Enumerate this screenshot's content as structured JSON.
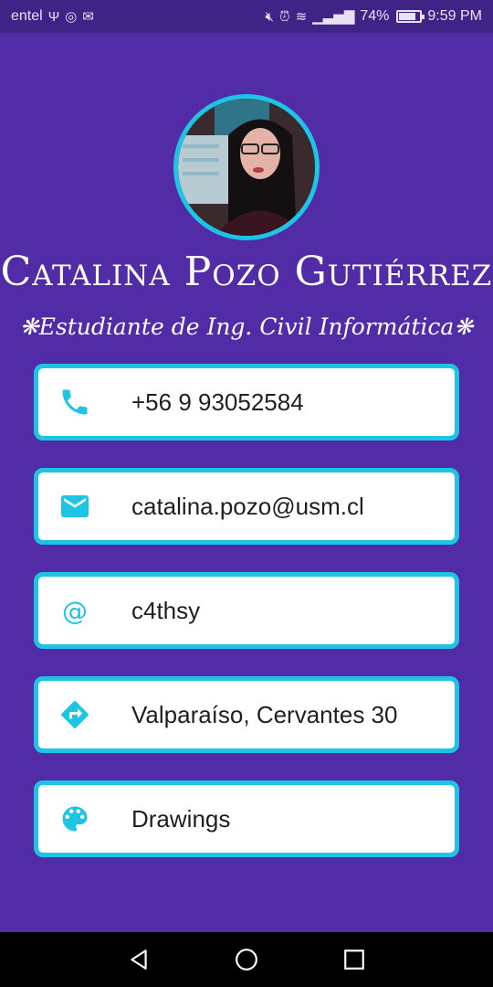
{
  "status_bar": {
    "carrier": "entel",
    "battery": "74%",
    "time": "9:59 PM"
  },
  "profile": {
    "name": "Catalina Pozo Gutiérrez",
    "subtitle": "❋Estudiante de Ing. Civil Informática❋"
  },
  "contacts": [
    {
      "icon": "phone-icon",
      "value": "+56 9 93052584"
    },
    {
      "icon": "email-icon",
      "value": "catalina.pozo@usm.cl"
    },
    {
      "icon": "at-icon",
      "value": "c4thsy"
    },
    {
      "icon": "directions-icon",
      "value": "Valparaíso, Cervantes 30"
    },
    {
      "icon": "palette-icon",
      "value": "Drawings"
    }
  ],
  "colors": {
    "background": "#522ca6",
    "accent": "#1ec4e4",
    "status_bar": "#3f2387",
    "card": "#ffffff"
  },
  "nav": [
    "back-icon",
    "home-icon",
    "recents-icon"
  ]
}
